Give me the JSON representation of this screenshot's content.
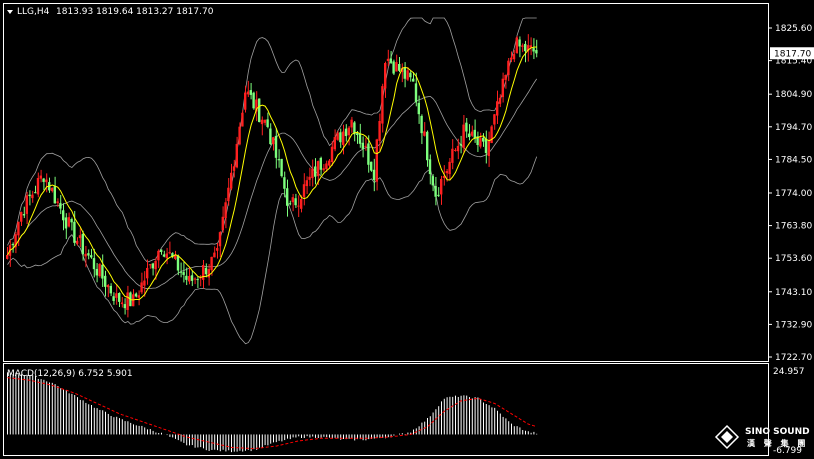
{
  "header": {
    "symbol": "LLG,H4",
    "ohlc": "1813.93 1819.64 1813.27 1817.70",
    "dropdown_icon": "triangle-down-icon"
  },
  "watermark": {
    "brand": "SINO SOUND",
    "sub": "漢 聲 集 團",
    "logo_icon": "diamond-logo-icon"
  },
  "colors": {
    "background": "#000000",
    "bull": "#ff2020",
    "bear": "#7dff7d",
    "ma": "#ffff00",
    "bands": "#a0a0a0",
    "macd_hist": "#ffffff",
    "macd_signal": "#ff0000",
    "frame": "#ffffff"
  },
  "chart_data": [
    {
      "type": "candlestick",
      "title": "",
      "indicators": [
        "Bollinger Bands",
        "Moving Average"
      ],
      "y_ticks": [
        "1825.60",
        "1815.40",
        "1804.90",
        "1794.70",
        "1784.50",
        "1774.00",
        "1763.80",
        "1753.60",
        "1743.10",
        "1732.90",
        "1722.70"
      ],
      "last_price": "1817.70",
      "ylim": [
        1722.7,
        1825.6
      ],
      "grid": false,
      "segments": [
        {
          "bars": 6,
          "from": 1752,
          "to": 1768
        },
        {
          "bars": 8,
          "from": 1768,
          "to": 1780
        },
        {
          "bars": 10,
          "from": 1780,
          "to": 1762
        },
        {
          "bars": 16,
          "from": 1762,
          "to": 1741
        },
        {
          "bars": 6,
          "from": 1741,
          "to": 1740
        },
        {
          "bars": 10,
          "from": 1740,
          "to": 1758
        },
        {
          "bars": 10,
          "from": 1758,
          "to": 1746
        },
        {
          "bars": 10,
          "from": 1746,
          "to": 1754
        },
        {
          "bars": 10,
          "from": 1754,
          "to": 1806
        },
        {
          "bars": 8,
          "from": 1806,
          "to": 1795
        },
        {
          "bars": 8,
          "from": 1795,
          "to": 1769
        },
        {
          "bars": 10,
          "from": 1769,
          "to": 1782
        },
        {
          "bars": 12,
          "from": 1782,
          "to": 1797
        },
        {
          "bars": 8,
          "from": 1797,
          "to": 1781
        },
        {
          "bars": 4,
          "from": 1781,
          "to": 1817
        },
        {
          "bars": 10,
          "from": 1817,
          "to": 1808
        },
        {
          "bars": 8,
          "from": 1808,
          "to": 1774
        },
        {
          "bars": 10,
          "from": 1774,
          "to": 1793
        },
        {
          "bars": 8,
          "from": 1793,
          "to": 1787
        },
        {
          "bars": 10,
          "from": 1787,
          "to": 1820
        },
        {
          "bars": 8,
          "from": 1820,
          "to": 1818
        }
      ]
    },
    {
      "type": "macd",
      "label": "MACD(12,26,9) 6.752 5.901",
      "y_ticks": [
        "24.957",
        "-6.799"
      ],
      "ylim": [
        -6.799,
        24.957
      ],
      "macd_path": [
        [
          0,
          24
        ],
        [
          8,
          23
        ],
        [
          16,
          20
        ],
        [
          24,
          15
        ],
        [
          32,
          10
        ],
        [
          40,
          6
        ],
        [
          48,
          3
        ],
        [
          56,
          0
        ],
        [
          64,
          -4
        ],
        [
          72,
          -6
        ],
        [
          80,
          -6.5
        ],
        [
          88,
          -6
        ],
        [
          96,
          -3
        ],
        [
          104,
          -1
        ],
        [
          112,
          -1
        ],
        [
          120,
          -2
        ],
        [
          128,
          -2
        ],
        [
          136,
          -1
        ],
        [
          144,
          1
        ],
        [
          150,
          6
        ],
        [
          156,
          14
        ],
        [
          162,
          15
        ],
        [
          168,
          14
        ],
        [
          174,
          10
        ],
        [
          180,
          4
        ],
        [
          186,
          1
        ],
        [
          192,
          0
        ],
        [
          198,
          1
        ],
        [
          204,
          3
        ],
        [
          210,
          4
        ],
        [
          216,
          5
        ],
        [
          222,
          5
        ],
        [
          228,
          4
        ],
        [
          234,
          1
        ],
        [
          240,
          -1
        ],
        [
          246,
          -2
        ],
        [
          252,
          -1
        ],
        [
          258,
          1
        ],
        [
          264,
          4
        ],
        [
          270,
          6
        ],
        [
          276,
          7
        ]
      ],
      "signal_path": [
        [
          0,
          22
        ],
        [
          8,
          21
        ],
        [
          16,
          19
        ],
        [
          24,
          16
        ],
        [
          32,
          12
        ],
        [
          40,
          8
        ],
        [
          48,
          5
        ],
        [
          56,
          2
        ],
        [
          64,
          -1
        ],
        [
          72,
          -3
        ],
        [
          80,
          -5
        ],
        [
          88,
          -5.5
        ],
        [
          96,
          -4.5
        ],
        [
          104,
          -2.5
        ],
        [
          112,
          -1.5
        ],
        [
          120,
          -1.5
        ],
        [
          128,
          -1.5
        ],
        [
          136,
          -1
        ],
        [
          144,
          0
        ],
        [
          150,
          3
        ],
        [
          156,
          9
        ],
        [
          162,
          13
        ],
        [
          168,
          14
        ],
        [
          174,
          12
        ],
        [
          180,
          8
        ],
        [
          186,
          4
        ],
        [
          192,
          2
        ],
        [
          198,
          1
        ],
        [
          204,
          2
        ],
        [
          210,
          3
        ],
        [
          216,
          4
        ],
        [
          222,
          4.5
        ],
        [
          228,
          4
        ],
        [
          234,
          2
        ],
        [
          240,
          0.5
        ],
        [
          246,
          -0.5
        ],
        [
          252,
          -0.5
        ],
        [
          258,
          0.5
        ],
        [
          264,
          2.5
        ],
        [
          270,
          4.5
        ],
        [
          276,
          5.9
        ]
      ]
    }
  ]
}
